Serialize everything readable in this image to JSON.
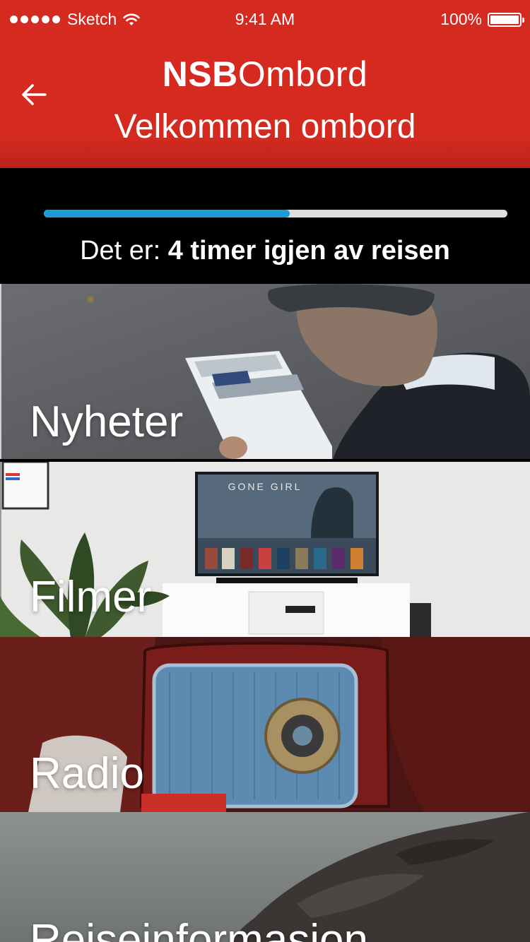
{
  "status_bar": {
    "carrier": "Sketch",
    "time": "9:41 AM",
    "battery": "100%"
  },
  "header": {
    "brand_bold": "NSB",
    "brand_regular": "Ombord",
    "subtitle": "Velkommen ombord"
  },
  "trip": {
    "prefix": "Det er: ",
    "remaining": "4 timer igjen av reisen",
    "progress": 0.53
  },
  "tiles": [
    {
      "label": "Nyheter"
    },
    {
      "label": "Filmer"
    },
    {
      "label": "Radio"
    },
    {
      "label": "Reiseinformasjon"
    }
  ],
  "movie_title": "GONE GIRL",
  "colors": {
    "header": "#d42a20",
    "progress_fill": "#1e9bd6",
    "progress_track": "#dedede"
  }
}
